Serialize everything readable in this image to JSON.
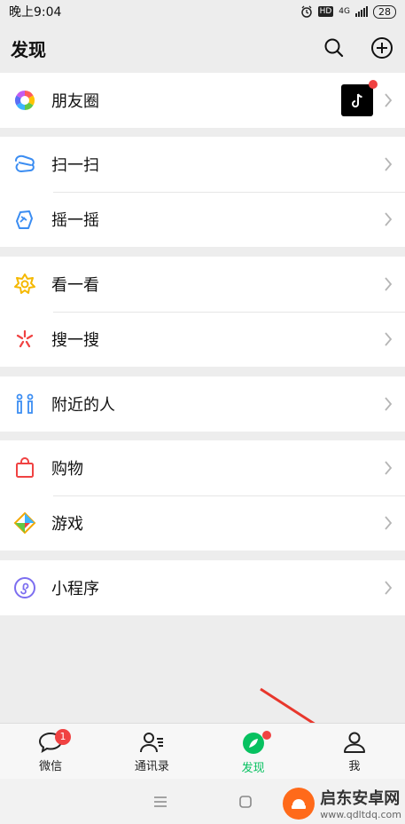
{
  "status": {
    "time": "晚上9:04",
    "network": "4G",
    "battery": "28",
    "hd": "HD"
  },
  "header": {
    "title": "发现"
  },
  "groups": [
    {
      "items": [
        {
          "label": "朋友圈",
          "icon": "moments-icon"
        }
      ]
    },
    {
      "items": [
        {
          "label": "扫一扫",
          "icon": "scan-icon"
        },
        {
          "label": "摇一摇",
          "icon": "shake-icon"
        }
      ]
    },
    {
      "items": [
        {
          "label": "看一看",
          "icon": "top-stories-icon"
        },
        {
          "label": "搜一搜",
          "icon": "search-icon"
        }
      ]
    },
    {
      "items": [
        {
          "label": "附近的人",
          "icon": "people-nearby-icon"
        }
      ]
    },
    {
      "items": [
        {
          "label": "购物",
          "icon": "shopping-icon"
        },
        {
          "label": "游戏",
          "icon": "games-icon"
        }
      ]
    },
    {
      "items": [
        {
          "label": "小程序",
          "icon": "mini-programs-icon"
        }
      ]
    }
  ],
  "tabs": [
    {
      "label": "微信",
      "badge": "1",
      "icon": "chats-icon"
    },
    {
      "label": "通讯录",
      "icon": "contacts-icon"
    },
    {
      "label": "发现",
      "icon": "discover-icon",
      "active": true
    },
    {
      "label": "我",
      "icon": "me-icon"
    }
  ],
  "watermark": {
    "title": "启东安卓网",
    "url": "www.qdltdq.com"
  },
  "colors": {
    "accent": "#07c160",
    "badge": "#f04242",
    "arrow": "#e8372c"
  }
}
